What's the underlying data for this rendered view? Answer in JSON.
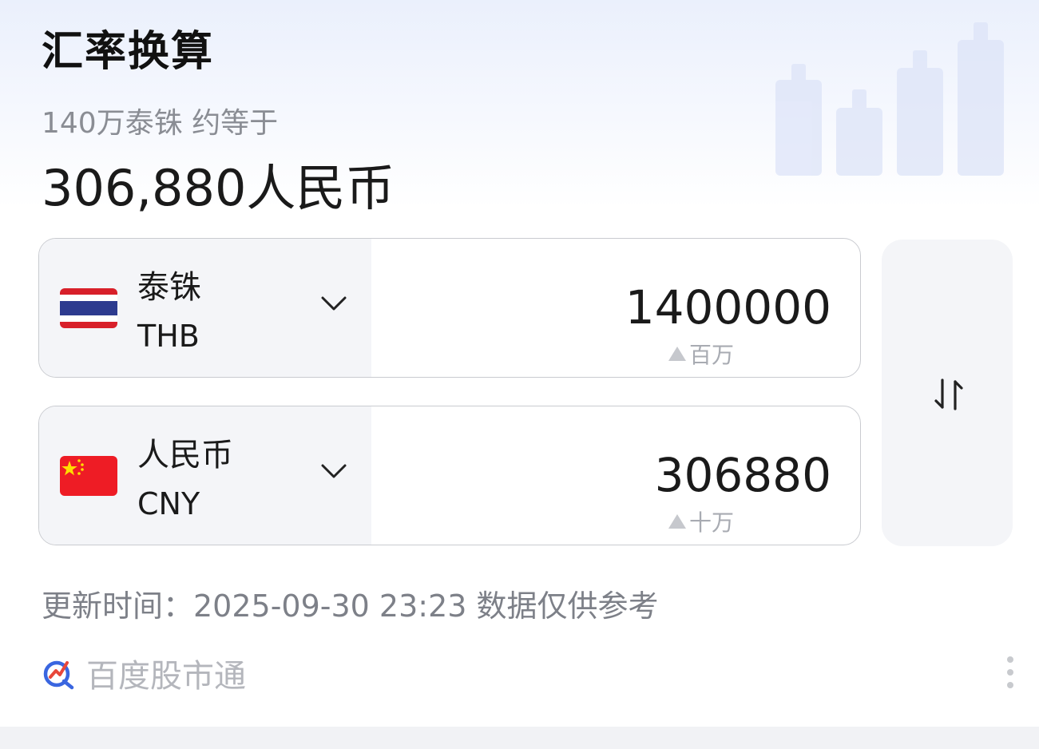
{
  "header": {
    "title": "汇率换算",
    "subtitle": "140万泰铢 约等于",
    "result": "306,880人民币"
  },
  "converter": {
    "source": {
      "currency_name": "泰铢",
      "currency_code": "THB",
      "amount": "1400000",
      "unit_hint": "百万",
      "flag": "thailand-flag-icon"
    },
    "target": {
      "currency_name": "人民币",
      "currency_code": "CNY",
      "amount": "306880",
      "unit_hint": "十万",
      "flag": "china-flag-icon"
    },
    "swap_icon": "swap-arrows-icon"
  },
  "update_info": "更新时间：2025-09-30 23:23 数据仅供参考",
  "footer": {
    "brand": "百度股市通",
    "more_icon": "more-vertical-icon"
  },
  "colors": {
    "accent_blue": "#3a66e0",
    "thai_red": "#d8202a",
    "thai_blue": "#2d3b8f",
    "china_red": "#ee1c25",
    "china_yellow": "#ffde00"
  }
}
